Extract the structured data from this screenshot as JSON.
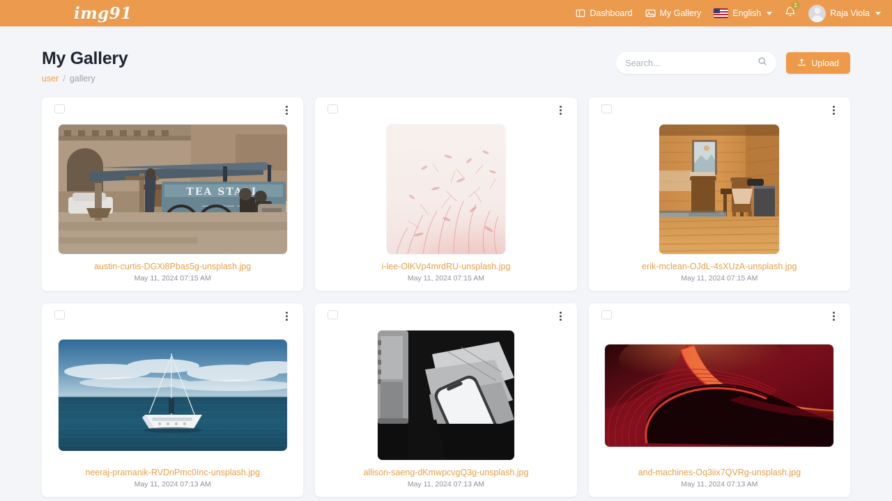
{
  "navbar": {
    "brand": "img91",
    "items": [
      {
        "label": "Dashboard",
        "icon": "dashboard-icon"
      },
      {
        "label": "My Gallery",
        "icon": "gallery-icon"
      }
    ],
    "language": {
      "label": "English",
      "flag": "us-flag-icon"
    },
    "notifications": {
      "count": "1",
      "icon": "bell-icon"
    },
    "user": {
      "name": "Raja Viola",
      "avatar": "user-avatar"
    },
    "background_color": "#ec9a4e"
  },
  "header": {
    "title": "My Gallery",
    "breadcrumb": {
      "parent": "user",
      "separator": "/",
      "current": "gallery"
    },
    "search": {
      "value": "",
      "placeholder": "Search...",
      "icon": "search-icon"
    },
    "upload": {
      "label": "Upload",
      "icon": "upload-icon",
      "color": "#ef9a48"
    }
  },
  "gallery": {
    "items": [
      {
        "filename": "austin-curtis-DGXi8Pbas5g-unsplash.jpg",
        "date": "May 11, 2024 07:15 AM",
        "selected": false
      },
      {
        "filename": "i-lee-OlKVp4mrdRU-unsplash.jpg",
        "date": "May 11, 2024 07:15 AM",
        "selected": false
      },
      {
        "filename": "erik-mclean-OJdL-4sXUzA-unsplash.jpg",
        "date": "May 11, 2024 07:15 AM",
        "selected": false
      },
      {
        "filename": "neeraj-pramanik-RVDnPmc0Inc-unsplash.jpg",
        "date": "May 11, 2024 07:13 AM",
        "selected": false
      },
      {
        "filename": "allison-saeng-dKmwpcvgQ3g-unsplash.jpg",
        "date": "May 11, 2024 07:13 AM",
        "selected": false
      },
      {
        "filename": "and-machines-Oq3iix7QVRg-unsplash.jpg",
        "date": "May 11, 2024 07:13 AM",
        "selected": false
      }
    ]
  }
}
